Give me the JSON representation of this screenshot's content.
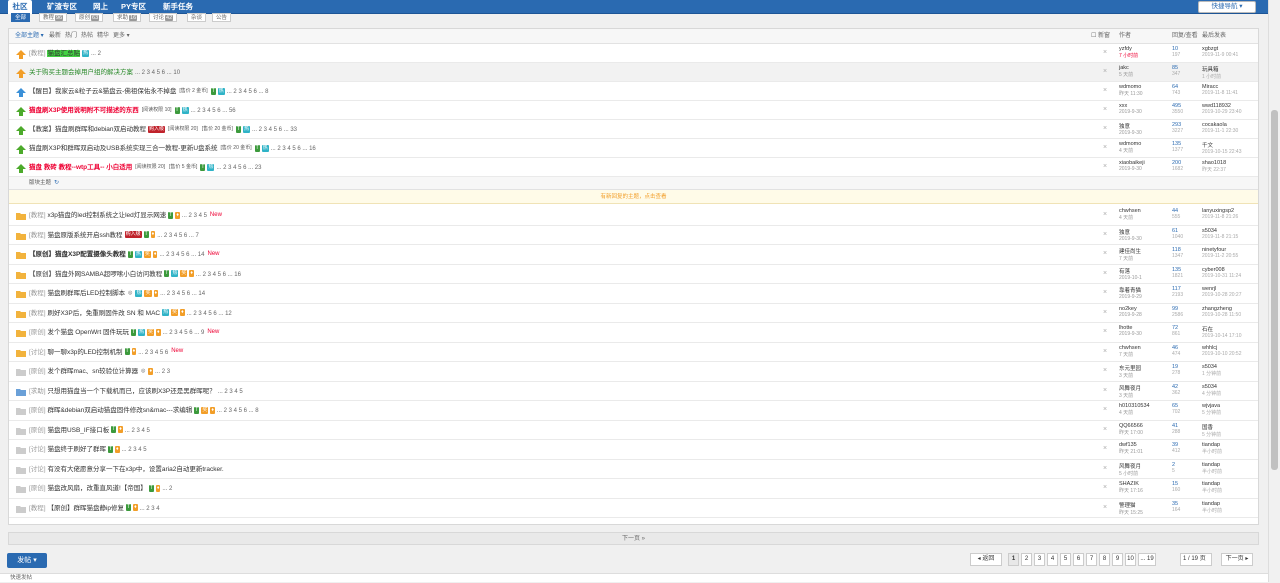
{
  "nav": {
    "items": [
      "社区",
      "矿渣专区",
      "网上",
      "PY专区",
      "新手任务"
    ],
    "quick_nav": "快捷导航 ▾"
  },
  "subtabs": [
    {
      "label": "全部",
      "count": ""
    },
    {
      "label": "教程",
      "count": "96"
    },
    {
      "label": "原创",
      "count": "63"
    },
    {
      "label": "求助",
      "count": "16"
    },
    {
      "label": "讨论",
      "count": "42"
    },
    {
      "label": "杂谈",
      "count": ""
    },
    {
      "label": "公告",
      "count": ""
    }
  ],
  "filter": {
    "all": "全部主题 ▾",
    "opts": [
      "最新",
      "热门",
      "热帖",
      "精华",
      "更多 ▾"
    ],
    "newwin": "新窗",
    "col_author": "作者",
    "col_rv": "回复/查看",
    "col_last": "最后发表"
  },
  "sticky": [
    {
      "cat": "[教程]",
      "title": "猫盘汇总贴",
      "hl": true,
      "badges": [
        {
          "t": "热",
          "c": "cy"
        }
      ],
      "pages": "... 2",
      "author": "yzfdy",
      "adate": "7 小时前",
      "rep": "10",
      "view": "197",
      "last": "xgbzgt",
      "ldate": "2019-11-9 00:41",
      "arrow": "orange"
    },
    {
      "cat": "",
      "title": "关于购买主题会掉用户组的解决方案",
      "color": "#2a8a2a",
      "badges": [],
      "pages": "... 2 3 4 5 6 ... 10",
      "author": "jakc",
      "adate": "5 天前",
      "rep": "85",
      "view": "347",
      "last": "玩具箱",
      "ldate": "1 小时前",
      "arrow": "orange"
    },
    {
      "cat": "",
      "title": "【醒目】我家云&粒子云&猫盘云-佛祖保佑永不掉盘",
      "badges": [
        {
          "t": "[售价 2 金币]",
          "c": "plain"
        },
        {
          "t": "T",
          "c": "gr"
        },
        {
          "t": "热",
          "c": "cy"
        }
      ],
      "pages": "... 2 3 4 5 6 ... 8",
      "author": "wdmomo",
      "adate": "昨天 11:30",
      "rep": "64",
      "view": "743",
      "last": "Miracc",
      "ldate": "2019-11-8 11:41",
      "arrow": "blue"
    },
    {
      "cat": "",
      "title": "猫盘刷X3P使用说明附不可描述的东西",
      "color": "#e03",
      "bold": true,
      "badges": [
        {
          "t": "[阅读权限 10]",
          "c": "plain"
        },
        {
          "t": "T",
          "c": "gr"
        },
        {
          "t": "热",
          "c": "cy"
        }
      ],
      "pages": "... 2 3 4 5 6 ... 56",
      "author": "xxx",
      "adate": "2019-9-30",
      "rep": "495",
      "view": "3550",
      "last": "wwd118932",
      "ldate": "2019-10-29 23:40",
      "arrow": "green"
    },
    {
      "cat": "",
      "title": "【教案】猫盘刷群晖和debian双启动教程",
      "badges": [
        {
          "t": "购入级",
          "c": "red"
        },
        {
          "t": "[阅读权限 20]",
          "c": "plain"
        },
        {
          "t": "[售价 20 金币]",
          "c": "plain"
        },
        {
          "t": "T",
          "c": "gr"
        },
        {
          "t": "热",
          "c": "cy"
        }
      ],
      "pages": "... 2 3 4 5 6 ... 33",
      "author": "独意",
      "adate": "2019-9-30",
      "rep": "293",
      "view": "3227",
      "last": "cocakaola",
      "ldate": "2019-11-1 22:30",
      "arrow": "green"
    },
    {
      "cat": "",
      "title": "猫盘刷X3P和群晖双启动及USB系统实现三合一教程-更新U盘系统",
      "badges": [
        {
          "t": "[售价 20 金币]",
          "c": "plain"
        },
        {
          "t": "T",
          "c": "gr"
        },
        {
          "t": "热",
          "c": "cy"
        }
      ],
      "pages": "... 2 3 4 5 6 ... 16",
      "author": "wdmomo",
      "adate": "4 天前",
      "rep": "135",
      "view": "1377",
      "last": "千文",
      "ldate": "2019-10-15 22:43",
      "arrow": "green"
    },
    {
      "cat": "",
      "title": "猫盘 救砖 教程--wtp工具-- 小白适用",
      "color": "#e03",
      "bold": true,
      "badges": [
        {
          "t": "[阅读权限 20]",
          "c": "plain"
        },
        {
          "t": "[售价 5 金币]",
          "c": "plain"
        },
        {
          "t": "T",
          "c": "gr"
        },
        {
          "t": "热",
          "c": "cy"
        }
      ],
      "pages": "... 2 3 4 5 6 ... 23",
      "author": "xiaobaikeji",
      "adate": "2019-9-30",
      "rep": "200",
      "view": "1682",
      "last": "shao1018",
      "ldate": "昨天 22:37",
      "arrow": "green"
    }
  ],
  "section_label": "版块主题",
  "notice": "有新回复的主题，点击查看",
  "threads": [
    {
      "cat": "[教程]",
      "title": "x3p猫盘的led控制系统之让led灯显示网速",
      "badges": [
        {
          "t": "T",
          "c": "gr"
        },
        {
          "t": "♦",
          "c": "or"
        }
      ],
      "pages": "... 2 3 4 5",
      "new": "New",
      "author": "chwhsen",
      "adate": "4 天前",
      "rep": "44",
      "view": "555",
      "last": "lanyuxingsp2",
      "ldate": "2019-11-8 21:26"
    },
    {
      "cat": "[教程]",
      "title": "猫盘原版系统开启ssh教程",
      "badges": [
        {
          "t": "购入级",
          "c": "red"
        },
        {
          "t": "T",
          "c": "gr"
        },
        {
          "t": "♦",
          "c": "or"
        }
      ],
      "pages": "... 2 3 4 5 6 ... 7",
      "new": "",
      "author": "独意",
      "adate": "2019-9-30",
      "rep": "61",
      "view": "1040",
      "last": "s5034",
      "ldate": "2019-11-8 21:15"
    },
    {
      "cat": "",
      "title": "【原创】猫盘X3P配置摄像头教程",
      "bold": true,
      "badges": [
        {
          "t": "T",
          "c": "gr"
        },
        {
          "t": "热",
          "c": "cy"
        },
        {
          "t": "奖",
          "c": "or"
        },
        {
          "t": "♦",
          "c": "or"
        }
      ],
      "pages": "... 2 3 4 5 6 ... 14",
      "new": "New",
      "author": "建佳尚生",
      "adate": "7 天前",
      "rep": "118",
      "view": "1347",
      "last": "ninetyfour",
      "ldate": "2019-11-2 20:55"
    },
    {
      "cat": "",
      "title": "【原创】猫盘外网SAMBA超啰嗦小白访问教程",
      "badges": [
        {
          "t": "T",
          "c": "gr"
        },
        {
          "t": "热",
          "c": "cy"
        },
        {
          "t": "奖",
          "c": "or"
        },
        {
          "t": "♦",
          "c": "or"
        }
      ],
      "pages": "... 2 3 4 5 6 ... 16",
      "new": "",
      "author": "有落",
      "adate": "2019-10-1",
      "rep": "135",
      "view": "1821",
      "last": "cyber008",
      "ldate": "2019-10-31 11:24"
    },
    {
      "cat": "[教程]",
      "title": "猫盘刷群晖后LED控制脚本",
      "badges": [
        {
          "t": "◎",
          "c": "plain"
        },
        {
          "t": "热",
          "c": "cy"
        },
        {
          "t": "奖",
          "c": "or"
        },
        {
          "t": "♦",
          "c": "or"
        }
      ],
      "pages": "... 2 3 4 5 6 ... 14",
      "new": "",
      "author": "靠着青猫",
      "adate": "2019-9-29",
      "rep": "117",
      "view": "2193",
      "last": "wenrjl",
      "ldate": "2019-10-28 20:27"
    },
    {
      "cat": "[教程]",
      "title": "刷好X3P后，免重刷固件改 SN 和 MAC",
      "badges": [
        {
          "t": "热",
          "c": "cy"
        },
        {
          "t": "奖",
          "c": "or"
        },
        {
          "t": "♦",
          "c": "or"
        }
      ],
      "pages": "... 2 3 4 5 6 ... 12",
      "new": "",
      "author": "no2key",
      "adate": "2019-9-28",
      "rep": "99",
      "view": "2586",
      "last": "zhangzheng",
      "ldate": "2019-10-28 11:50"
    },
    {
      "cat": "[原创]",
      "title": "发个猫盘 OpenWrt 固件玩玩",
      "badges": [
        {
          "t": "T",
          "c": "gr"
        },
        {
          "t": "热",
          "c": "cy"
        },
        {
          "t": "奖",
          "c": "or"
        },
        {
          "t": "♦",
          "c": "or"
        }
      ],
      "pages": "... 2 3 4 5 6 ... 9",
      "new": "New",
      "author": "lhotte",
      "adate": "2019-9-30",
      "rep": "72",
      "view": "861",
      "last": "石在",
      "ldate": "2019-10-14 17:10"
    },
    {
      "cat": "[讨论]",
      "title": "聊一聊x3p的LED控制机制",
      "badges": [
        {
          "t": "T",
          "c": "gr"
        },
        {
          "t": "♦",
          "c": "or"
        }
      ],
      "pages": "... 2 3 4 5 6",
      "new": "New",
      "author": "chwhsen",
      "adate": "7 天前",
      "rep": "46",
      "view": "474",
      "last": "whhlcj",
      "ldate": "2019-10-10 20:52"
    },
    {
      "cat": "[原创]",
      "title": "发个群晖mac、sn较验位计算器",
      "badges": [
        {
          "t": "◎",
          "c": "plain"
        },
        {
          "t": "♦",
          "c": "or"
        }
      ],
      "pages": "... 2 3",
      "new": "",
      "author": "东元里园",
      "adate": "3 天前",
      "rep": "19",
      "view": "278",
      "last": "s5034",
      "ldate": "1 分钟前"
    },
    {
      "cat": "[求助]",
      "title": "只想用猫盘当一个下载机而已，应该刷X3P还是黑群晖呢？",
      "badges": [],
      "pages": "... 2 3 4 5",
      "new": "",
      "author": "风舞夜月",
      "adate": "3 天前",
      "rep": "42",
      "view": "362",
      "last": "s5034",
      "ldate": "4 分钟前"
    },
    {
      "cat": "[原创]",
      "title": "群晖&debian双启动猫盘固件修改sn&mac---求编辑",
      "badges": [
        {
          "t": "T",
          "c": "gr"
        },
        {
          "t": "奖",
          "c": "or"
        },
        {
          "t": "♦",
          "c": "or"
        }
      ],
      "pages": "... 2 3 4 5 6 ... 8",
      "new": "",
      "author": "h010310534",
      "adate": "4 天前",
      "rep": "65",
      "view": "702",
      "last": "wjvjava",
      "ldate": "5 分钟前"
    },
    {
      "cat": "[原创]",
      "title": "猫盘用USB_IF接口板",
      "badges": [
        {
          "t": "T",
          "c": "gr"
        },
        {
          "t": "♦",
          "c": "or"
        }
      ],
      "pages": "... 2 3 4 5",
      "new": "",
      "author": "QQ66566",
      "adate": "昨天 17:00",
      "rep": "41",
      "view": "288",
      "last": "国香",
      "ldate": "5 分钟前"
    },
    {
      "cat": "[讨论]",
      "title": "猫盘终于刷好了群晖",
      "badges": [
        {
          "t": "T",
          "c": "gr"
        },
        {
          "t": "♦",
          "c": "or"
        }
      ],
      "pages": "... 2 3 4 5",
      "new": "",
      "author": "dwf135",
      "adate": "昨天 21:01",
      "rep": "39",
      "view": "412",
      "last": "tiandap",
      "ldate": "半小时前"
    },
    {
      "cat": "[讨论]",
      "title": "有没有大佬愿意分享一下在x3p中，设置aria2自动更新tracker.",
      "badges": [],
      "pages": "",
      "new": "",
      "author": "风舞夜月",
      "adate": "5 小时前",
      "rep": "2",
      "view": "5",
      "last": "tiandap",
      "ldate": "半小时前"
    },
    {
      "cat": "[原创]",
      "title": "猫盘改风扇，改重直风道!【帝国】",
      "badges": [
        {
          "t": "T",
          "c": "gr"
        },
        {
          "t": "♦",
          "c": "or"
        }
      ],
      "pages": "... 2",
      "new": "",
      "author": "SHAZIK",
      "adate": "昨天 17:16",
      "rep": "15",
      "view": "160",
      "last": "tiandap",
      "ldate": "半小时前"
    },
    {
      "cat": "[教程]",
      "title": "【原创】群晖猫盘静ip修复",
      "badges": [
        {
          "t": "T",
          "c": "gr"
        },
        {
          "t": "♦",
          "c": "or"
        }
      ],
      "pages": "... 2 3 4",
      "new": "",
      "author": "警理猫",
      "adate": "昨天 15:25",
      "rep": "35",
      "view": "164",
      "last": "tiandap",
      "ldate": "半小时前"
    }
  ],
  "next_page": "下一页 »",
  "post_button": "发帖 ▾",
  "pager": {
    "back": "◂ 返回",
    "pages": [
      "1",
      "2",
      "3",
      "4",
      "5",
      "6",
      "7",
      "8",
      "9",
      "10",
      "... 19"
    ],
    "current": "1",
    "total": "/ 19 页",
    "next": "下一页 ▸"
  },
  "footer": "快速发帖"
}
